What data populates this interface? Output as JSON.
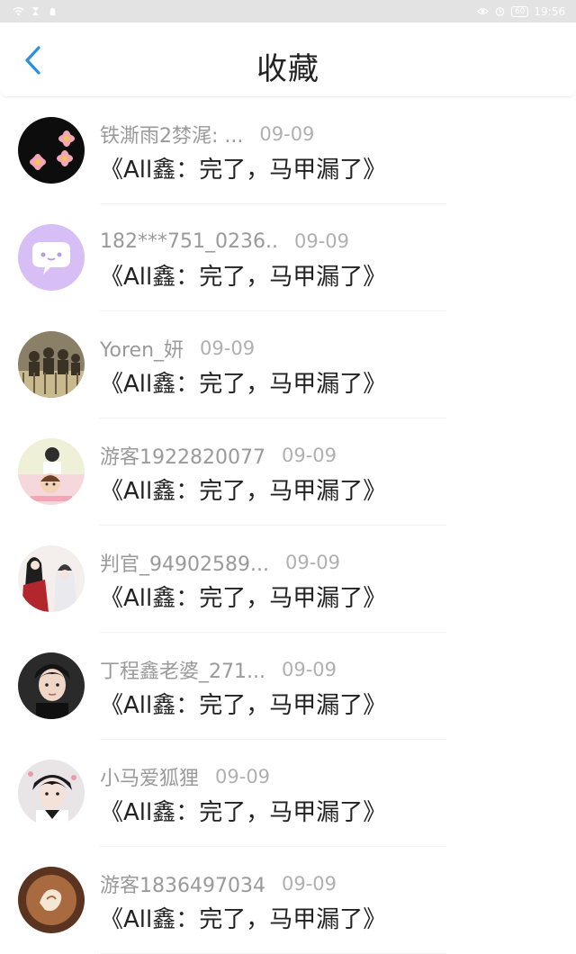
{
  "status_bar": {
    "time": "19:56",
    "battery": "60",
    "icons_left": [
      "wifi-icon",
      "sim-icon",
      "notification-icon"
    ],
    "icons_right": [
      "eye-icon",
      "alarm-icon",
      "battery-icon"
    ]
  },
  "header": {
    "title": "收藏",
    "back_icon": "chevron-left-icon"
  },
  "colors": {
    "accent": "#2b8fe0",
    "username": "#9a9a9a",
    "date": "#b0b0b0",
    "content": "#222222",
    "status_bar_bg": "#e3e3e3"
  },
  "items": [
    {
      "username": "铁澌雨2棼浘: ...",
      "date": "09-09",
      "content": "《All鑫：完了，马甲漏了》",
      "avatar": "flowers-avatar"
    },
    {
      "username": "182***751_0236..",
      "date": "09-09",
      "content": "《All鑫：完了，马甲漏了》",
      "avatar": "chat-bubble-avatar"
    },
    {
      "username": "Yoren_妍",
      "date": "09-09",
      "content": "《All鑫：完了，马甲漏了》",
      "avatar": "group-photo-avatar"
    },
    {
      "username": "游客1922820077",
      "date": "09-09",
      "content": "《All鑫：完了，马甲漏了》",
      "avatar": "cartoon-photo-avatar"
    },
    {
      "username": "判官_94902589...",
      "date": "09-09",
      "content": "《All鑫：完了，马甲漏了》",
      "avatar": "painting-avatar"
    },
    {
      "username": "丁程鑫老婆_271...",
      "date": "09-09",
      "content": "《All鑫：完了，马甲漏了》",
      "avatar": "portrait-avatar"
    },
    {
      "username": "小马爱狐狸",
      "date": "09-09",
      "content": "《All鑫：完了，马甲漏了》",
      "avatar": "portrait-avatar-2"
    },
    {
      "username": "游客1836497034",
      "date": "09-09",
      "content": "《All鑫：完了，马甲漏了》",
      "avatar": "latte-art-avatar"
    }
  ]
}
